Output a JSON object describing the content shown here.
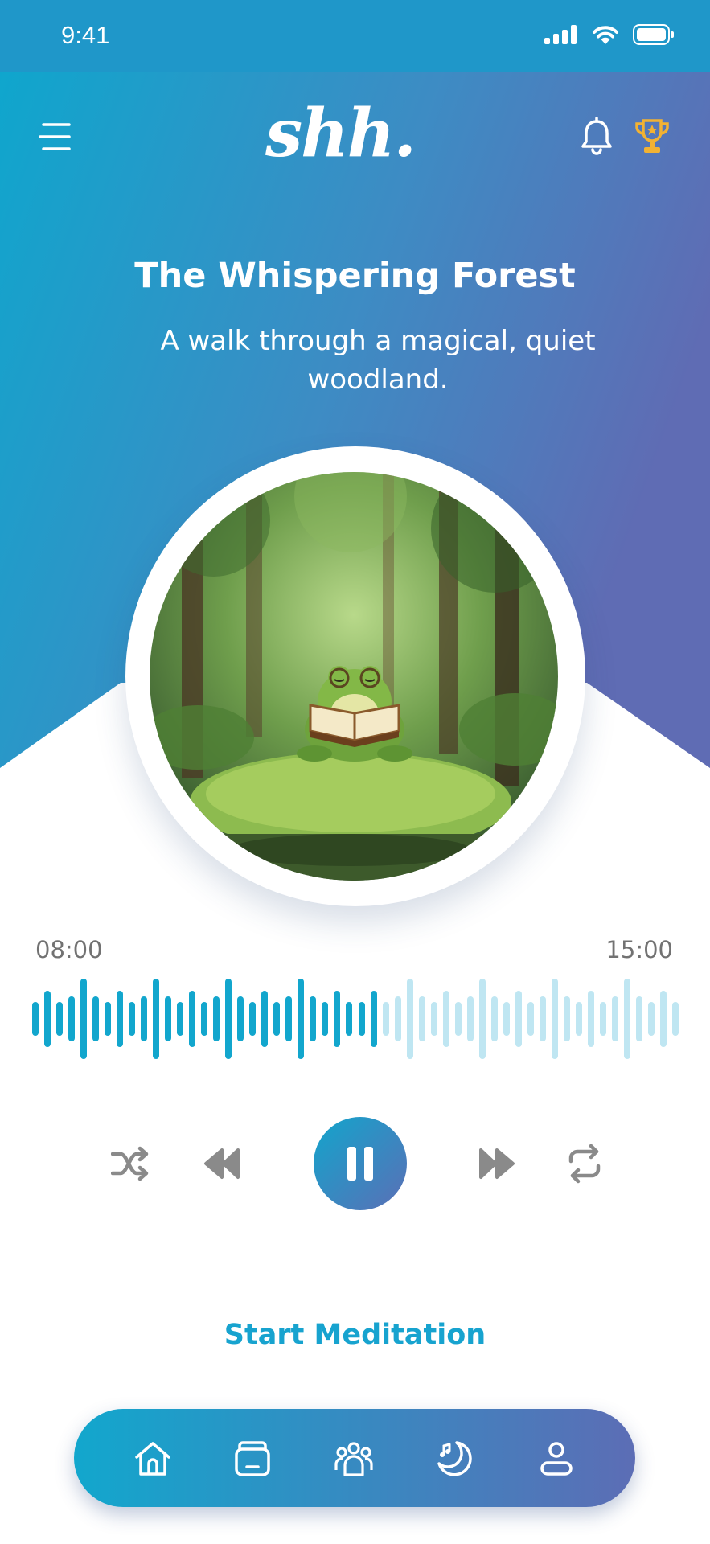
{
  "status": {
    "time": "9:41"
  },
  "header": {
    "logo": "shh."
  },
  "track": {
    "title": "The Whispering Forest",
    "subtitle": "A walk through a magical, quiet woodland.",
    "elapsed": "08:00",
    "duration": "15:00",
    "progress": 0.533
  },
  "controls": {
    "main_state": "pause"
  },
  "cta": {
    "label": "Start Meditation"
  },
  "nav": {
    "items": [
      "home-icon",
      "journal-icon",
      "community-icon",
      "sleep-icon",
      "profile-icon"
    ]
  },
  "colors": {
    "accent": "#17a3cf",
    "gradient_start": "#12a7cd",
    "gradient_end": "#5c6db5",
    "wave_played": "#12a6cd",
    "wave_unplayed": "#bfe6f2",
    "trophy": "#f2b233",
    "control_gray": "#8a8a8a"
  }
}
